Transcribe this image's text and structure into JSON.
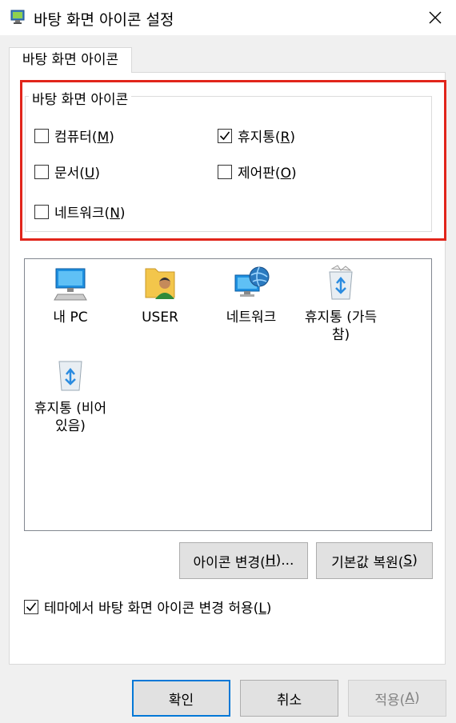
{
  "window": {
    "title": "바탕 화면 아이콘 설정",
    "icon": "display-settings-icon",
    "close_icon": "close-icon"
  },
  "tab": {
    "label": "바탕 화면 아이콘"
  },
  "group": {
    "title": "바탕 화면 아이콘",
    "checkboxes": [
      {
        "label": "컴퓨터(",
        "key": "M",
        "checked": false
      },
      {
        "label": "휴지통(",
        "key": "R",
        "checked": true
      },
      {
        "label": "문서(",
        "key": "U",
        "checked": false
      },
      {
        "label": "제어판(",
        "key": "O",
        "checked": false
      },
      {
        "label": "네트워크(",
        "key": "N",
        "checked": false
      }
    ]
  },
  "icons": [
    {
      "line1": "내 PC",
      "line2": "",
      "icon": "this-pc-icon"
    },
    {
      "line1": "USER",
      "line2": "",
      "icon": "user-folder-icon"
    },
    {
      "line1": "네트워크",
      "line2": "",
      "icon": "network-icon"
    },
    {
      "line1": "휴지통 (가득",
      "line2": "참)",
      "icon": "recycle-bin-full-icon"
    },
    {
      "line1": "휴지통 (비어",
      "line2": "있음)",
      "icon": "recycle-bin-empty-icon"
    }
  ],
  "buttons": {
    "change_icon": {
      "label": "아이콘 변경(",
      "key": "H",
      "suffix": ")..."
    },
    "restore_default": {
      "label": "기본값 복원(",
      "key": "S",
      "suffix": ")"
    },
    "ok": "확인",
    "cancel": "취소",
    "apply": {
      "label": "적용(",
      "key": "A",
      "suffix": ")"
    }
  },
  "theme_checkbox": {
    "label": "테마에서 바탕 화면 아이콘 변경 허용(",
    "key": "L",
    "suffix": ")",
    "checked": true
  },
  "colors": {
    "highlight": "#e1251b",
    "default_button_border": "#0078d7"
  }
}
